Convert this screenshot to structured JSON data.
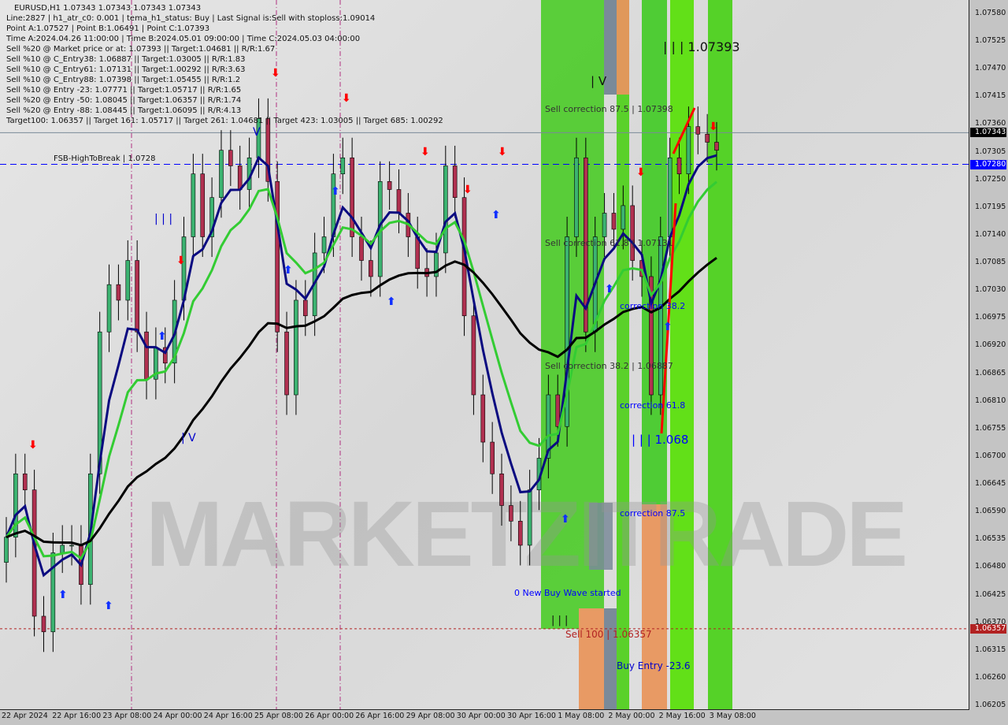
{
  "header": {
    "title": "EURUSD,H1  1.07343 1.07343 1.07343 1.07343",
    "lines": [
      "Line:2827 | h1_atr_c0: 0.001 | tema_h1_status: Buy | Last Signal is:Sell with stoploss:1.09014",
      "Point A:1.07527 | Point B:1.06491 | Point C:1.07393",
      "Time A:2024.04.26 11:00:00 | Time B:2024.05.01 09:00:00 | Time C:2024.05.03 04:00:00",
      "Sell %20 @ Market price or at: 1.07393 || Target:1.04681 || R/R:1.67",
      "Sell %10 @ C_Entry38: 1.06887 || Target:1.03005 || R/R:1.83",
      "Sell %10 @ C_Entry61: 1.07131 || Target:1.00292 || R/R:3.63",
      "Sell %10 @ C_Entry88: 1.07398 || Target:1.05455 || R/R:1.2",
      "Sell %10 @ Entry -23: 1.07771 || Target:1.05717 || R/R:1.65",
      "Sell %20 @ Entry -50: 1.08045 || Target:1.06357 || R/R:1.74",
      "Sell %20 @ Entry -88: 1.08445 || Target:1.06095 || R/R:4.13",
      "Target100: 1.06357 || Target 161: 1.05717 || Target 261: 1.04681 || Target 423: 1.03005 || Target 685: 1.00292"
    ]
  },
  "annotations": {
    "fsb": "FSB-HighToBreak | 1.0728",
    "wave3_top": "| | | 1.07393",
    "wave4": "| V",
    "wave3_left": "| | |",
    "wave4_left": "| V",
    "wave5_left": "V",
    "sell_corr_875": "Sell correction 87.5 | 1.07398",
    "sell_corr_618": "Sell correction 61.8 | 1.07131",
    "sell_corr_382": "Sell correction 38.2 | 1.06887",
    "corr_382": "correction 38.2",
    "corr_618": "correction 61.8",
    "corr_875": "correction 87.5",
    "wave3_low": "| | | 1.068",
    "new_buy": "0 New Buy Wave started",
    "wave_marks": "| | |",
    "sell100": "Sell 100 | 1.06357",
    "buy_entry": "Buy Entry -23.6"
  },
  "watermark": "MARKETZITRADE",
  "colors": {
    "bull": "#3cb371",
    "bear": "#b03050",
    "ma_fast": "#0a0a80",
    "ma_mid": "#33cc33",
    "ma_slow": "#000000",
    "band_green": "#5ad12a",
    "band_orange": "#e89a64",
    "band_gray": "#7a8a99",
    "accent_blue": "#0000ff",
    "accent_red": "#ff0000"
  },
  "chart_data": {
    "type": "candlestick",
    "symbol": "EURUSD",
    "timeframe": "H1",
    "ylim": [
      1.06205,
      1.0758
    ],
    "y_ticks": [
      "1.07580",
      "1.07525",
      "1.07470",
      "1.07415",
      "1.07360",
      "1.07305",
      "1.07250",
      "1.07195",
      "1.07140",
      "1.07085",
      "1.07030",
      "1.06975",
      "1.06920",
      "1.06865",
      "1.06810",
      "1.06755",
      "1.06700",
      "1.06645",
      "1.06590",
      "1.06535",
      "1.06480",
      "1.06425",
      "1.06370",
      "1.06315",
      "1.06260",
      "1.06205"
    ],
    "x_ticks": [
      "22 Apr 2024",
      "22 Apr 16:00",
      "23 Apr 08:00",
      "24 Apr 00:00",
      "24 Apr 16:00",
      "25 Apr 08:00",
      "26 Apr 00:00",
      "26 Apr 16:00",
      "29 Apr 08:00",
      "30 Apr 00:00",
      "30 Apr 16:00",
      "1 May 08:00",
      "2 May 00:00",
      "2 May 16:00",
      "3 May 08:00"
    ],
    "closes": [
      1.06539,
      1.06665,
      1.06633,
      1.06382,
      1.06351,
      1.06508,
      1.06523,
      1.06523,
      1.06445,
      1.06665,
      1.06947,
      1.07041,
      1.0701,
      1.07089,
      1.06947,
      1.06853,
      1.06916,
      1.06885,
      1.0701,
      1.07136,
      1.07261,
      1.07136,
      1.07214,
      1.07308,
      1.07277,
      1.0723,
      1.07293,
      1.07371,
      1.07246,
      1.06947,
      1.06822,
      1.0701,
      1.06979,
      1.07104,
      1.07136,
      1.07261,
      1.07293,
      1.07136,
      1.07089,
      1.07057,
      1.07246,
      1.0723,
      1.07183,
      1.07136,
      1.07073,
      1.07057,
      1.07104,
      1.07277,
      1.07214,
      1.06979,
      1.06822,
      1.06728,
      1.06665,
      1.06602,
      1.06571,
      1.06523,
      1.06633,
      1.06696,
      1.06822,
      1.06759,
      1.07136,
      1.07293,
      1.06947,
      1.07136,
      1.07183,
      1.07151,
      1.07198,
      1.07089,
      1.07057,
      1.06822,
      1.07136,
      1.07293,
      1.07261,
      1.07355,
      1.0734,
      1.07324,
      1.07308
    ],
    "hlines": [
      {
        "price": 1.07343,
        "label": "1.07343",
        "color": "#000000",
        "style": "solid"
      },
      {
        "price": 1.0728,
        "label": "1.07280",
        "color": "#0000ff",
        "style": "dashed"
      },
      {
        "price": 1.06357,
        "label": "1.06357",
        "color": "#b22222",
        "style": "dotted"
      }
    ],
    "grid": false
  }
}
